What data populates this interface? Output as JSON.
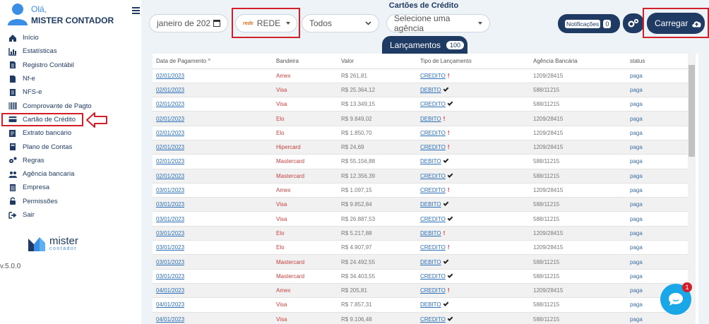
{
  "user": {
    "greeting": "Olá,",
    "name": "MISTER CONTADOR"
  },
  "nav": [
    {
      "label": "Início",
      "icon": "home-icon"
    },
    {
      "label": "Estatísticas",
      "icon": "bar-chart-icon"
    },
    {
      "label": "Registro Contábil",
      "icon": "document-icon"
    },
    {
      "label": "Nf-e",
      "icon": "file-icon"
    },
    {
      "label": "NFS-e",
      "icon": "list-file-icon"
    },
    {
      "label": "Comprovante de Pagto",
      "icon": "barcode-icon"
    },
    {
      "label": "Cartão de Crédito",
      "icon": "credit-card-icon"
    },
    {
      "label": "Extrato bancário",
      "icon": "statement-icon"
    },
    {
      "label": "Plano de Contas",
      "icon": "book-icon"
    },
    {
      "label": "Regras",
      "icon": "gears-icon"
    },
    {
      "label": "Agência bancaria",
      "icon": "users-icon"
    },
    {
      "label": "Empresa",
      "icon": "building-icon"
    },
    {
      "label": "Permissões",
      "icon": "lock-icon"
    },
    {
      "label": "Sair",
      "icon": "logout-icon"
    }
  ],
  "logo": {
    "line1": "mister",
    "line2": "contador"
  },
  "version": "v.5.0.0",
  "page": {
    "title": "Cartões de Crédito"
  },
  "filters": {
    "date": "janeiro de 202",
    "flag_logo": "rede",
    "flag": "REDE",
    "type": "Todos",
    "agency": "Selecione uma agência"
  },
  "buttons": {
    "notifications": "Notificações",
    "notifications_count": "0",
    "load": "Carregar"
  },
  "tab": {
    "label": "Lançamentos",
    "count": "100"
  },
  "table": {
    "headers": [
      "Data de Pagamento ^",
      "Bandeira",
      "Valor",
      "Tipo de Lançamento",
      "Agência Bancária",
      "status"
    ],
    "rows": [
      {
        "date": "02/01/2023",
        "flag": "Amex",
        "value": "R$ 261,81",
        "type": "CREDITO",
        "mark": "!",
        "agency": "1209/28415",
        "status": "paga"
      },
      {
        "date": "02/01/2023",
        "flag": "Visa",
        "value": "R$ 25.364,12",
        "type": "DEBITO",
        "mark": "check",
        "agency": "588/11215",
        "status": "paga"
      },
      {
        "date": "02/01/2023",
        "flag": "Visa",
        "value": "R$ 13.349,15",
        "type": "CREDITO",
        "mark": "check",
        "agency": "588/11215",
        "status": "paga"
      },
      {
        "date": "02/01/2023",
        "flag": "Elo",
        "value": "R$ 9.849,02",
        "type": "DEBITO",
        "mark": "!",
        "agency": "1209/28415",
        "status": "paga"
      },
      {
        "date": "02/01/2023",
        "flag": "Elo",
        "value": "R$ 1.850,70",
        "type": "CREDITO",
        "mark": "!",
        "agency": "1209/28415",
        "status": "paga"
      },
      {
        "date": "02/01/2023",
        "flag": "Hipercard",
        "value": "R$ 24,69",
        "type": "CREDITO",
        "mark": "!",
        "agency": "1209/28415",
        "status": "paga"
      },
      {
        "date": "02/01/2023",
        "flag": "Mastercard",
        "value": "R$ 55.156,88",
        "type": "DEBITO",
        "mark": "check",
        "agency": "588/11215",
        "status": "paga"
      },
      {
        "date": "02/01/2023",
        "flag": "Mastercard",
        "value": "R$ 12.356,39",
        "type": "CREDITO",
        "mark": "check",
        "agency": "588/11215",
        "status": "paga"
      },
      {
        "date": "03/01/2023",
        "flag": "Amex",
        "value": "R$ 1.097,15",
        "type": "CREDITO",
        "mark": "!",
        "agency": "1209/28415",
        "status": "paga"
      },
      {
        "date": "03/01/2023",
        "flag": "Visa",
        "value": "R$ 9.852,84",
        "type": "DEBITO",
        "mark": "check",
        "agency": "588/11215",
        "status": "paga"
      },
      {
        "date": "03/01/2023",
        "flag": "Visa",
        "value": "R$ 26.887,53",
        "type": "CREDITO",
        "mark": "check",
        "agency": "588/11215",
        "status": "paga"
      },
      {
        "date": "03/01/2023",
        "flag": "Elo",
        "value": "R$ 5.217,88",
        "type": "DEBITO",
        "mark": "!",
        "agency": "1209/28415",
        "status": "paga"
      },
      {
        "date": "03/01/2023",
        "flag": "Elo",
        "value": "R$ 4.907,97",
        "type": "CREDITO",
        "mark": "!",
        "agency": "1209/28415",
        "status": "paga"
      },
      {
        "date": "03/01/2023",
        "flag": "Mastercard",
        "value": "R$ 24.492,55",
        "type": "DEBITO",
        "mark": "check",
        "agency": "588/11215",
        "status": "paga"
      },
      {
        "date": "03/01/2023",
        "flag": "Mastercard",
        "value": "R$ 34.403,55",
        "type": "CREDITO",
        "mark": "check",
        "agency": "588/11215",
        "status": "paga"
      },
      {
        "date": "04/01/2023",
        "flag": "Amex",
        "value": "R$ 205,81",
        "type": "CREDITO",
        "mark": "!",
        "agency": "1209/28415",
        "status": "paga"
      },
      {
        "date": "04/01/2023",
        "flag": "Visa",
        "value": "R$ 7.857,31",
        "type": "DEBITO",
        "mark": "check",
        "agency": "588/11215",
        "status": "paga"
      },
      {
        "date": "04/01/2023",
        "flag": "Visa",
        "value": "R$ 9.106,48",
        "type": "CREDITO",
        "mark": "check",
        "agency": "588/11215",
        "status": "paga"
      }
    ]
  },
  "chat": {
    "badge": "1"
  },
  "colors": {
    "navy": "#1f3a63",
    "highlight": "#d21f2a",
    "link": "#2a6fb8",
    "chat": "#1aa7e8"
  }
}
